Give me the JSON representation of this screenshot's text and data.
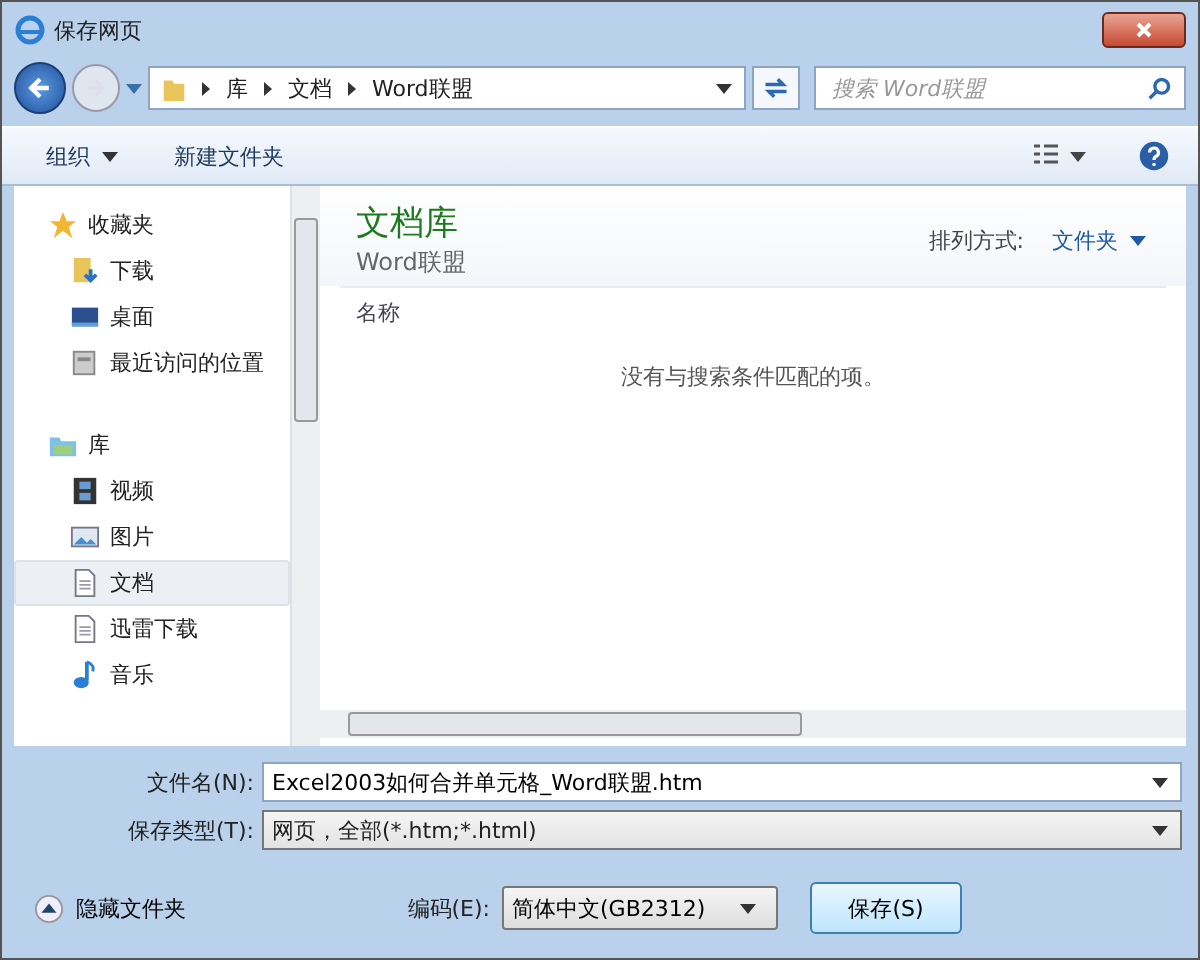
{
  "window": {
    "title": "保存网页"
  },
  "address": {
    "crumbs": [
      "库",
      "文档",
      "Word联盟"
    ]
  },
  "search": {
    "placeholder": "搜索 Word联盟"
  },
  "toolbar": {
    "organize": "组织",
    "new_folder": "新建文件夹"
  },
  "sidebar": {
    "items": [
      {
        "label": "收藏夹",
        "kind": "group",
        "selected": false
      },
      {
        "label": "下载",
        "kind": "item",
        "selected": false
      },
      {
        "label": "桌面",
        "kind": "item",
        "selected": false
      },
      {
        "label": "最近访问的位置",
        "kind": "item",
        "selected": false
      },
      {
        "label": "库",
        "kind": "group",
        "selected": false
      },
      {
        "label": "视频",
        "kind": "item",
        "selected": false
      },
      {
        "label": "图片",
        "kind": "item",
        "selected": false
      },
      {
        "label": "文档",
        "kind": "item",
        "selected": true
      },
      {
        "label": "迅雷下载",
        "kind": "item",
        "selected": false
      },
      {
        "label": "音乐",
        "kind": "item",
        "selected": false
      }
    ]
  },
  "content": {
    "title": "文档库",
    "subtitle": "Word联盟",
    "arrange_label": "排列方式:",
    "arrange_value": "文件夹",
    "column": "名称",
    "empty_message": "没有与搜索条件匹配的项。"
  },
  "form": {
    "filename_label": "文件名(N):",
    "filename": "Excel2003如何合并单元格_Word联盟.htm",
    "type_label": "保存类型(T):",
    "type": "网页，全部(*.htm;*.html)"
  },
  "footer": {
    "hide_folders": "隐藏文件夹",
    "encoding_label": "编码(E):",
    "encoding": "简体中文(GB2312)",
    "save": "保存(S)"
  }
}
